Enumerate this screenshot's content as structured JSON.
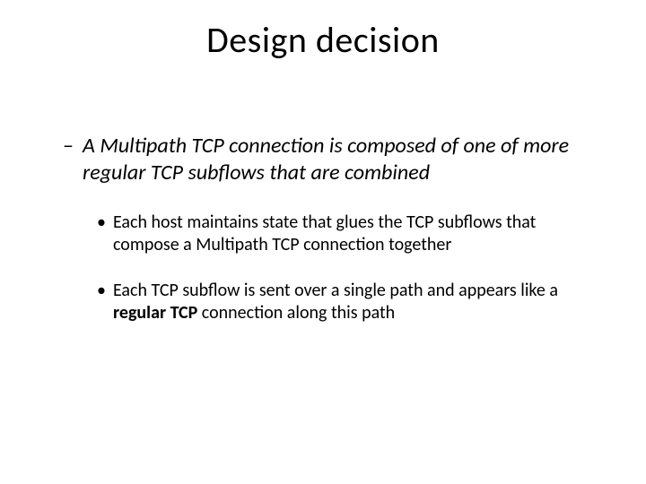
{
  "title": "Design decision",
  "main_point": {
    "dash": "–",
    "text": "A Multipath TCP connection is composed of one of more regular TCP subflows that are combined"
  },
  "sub_points": [
    {
      "bullet": "•",
      "text": "Each host maintains state that glues the TCP subflows that compose a Multipath TCP connection together"
    },
    {
      "bullet": "•",
      "prefix": "Each TCP subflow is sent over a single path and appears like a ",
      "bold": "regular TCP",
      "suffix": " connection along this path"
    }
  ]
}
